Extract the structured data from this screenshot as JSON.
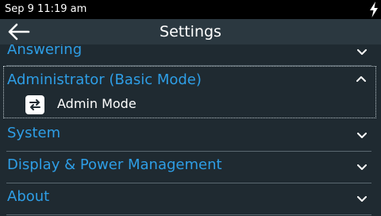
{
  "status_bar": {
    "time": "Sep 9 11:19 am",
    "charging_icon": "lightning-bolt-icon"
  },
  "header": {
    "title": "Settings",
    "back_icon": "arrow-left-icon"
  },
  "menu": {
    "items": [
      {
        "label": "Answering",
        "expanded": false
      },
      {
        "label": "Administrator (Basic Mode)",
        "expanded": true,
        "children": [
          {
            "label": "Admin Mode",
            "icon": "swap-arrows-icon"
          }
        ]
      },
      {
        "label": "System",
        "expanded": false
      },
      {
        "label": "Display & Power Management",
        "expanded": false
      },
      {
        "label": "About",
        "expanded": false
      }
    ]
  },
  "colors": {
    "background": "#1f2a31",
    "header": "#2b3840",
    "status_bar": "#000000",
    "accent": "#2e9ee6",
    "divider": "#5a6870"
  }
}
